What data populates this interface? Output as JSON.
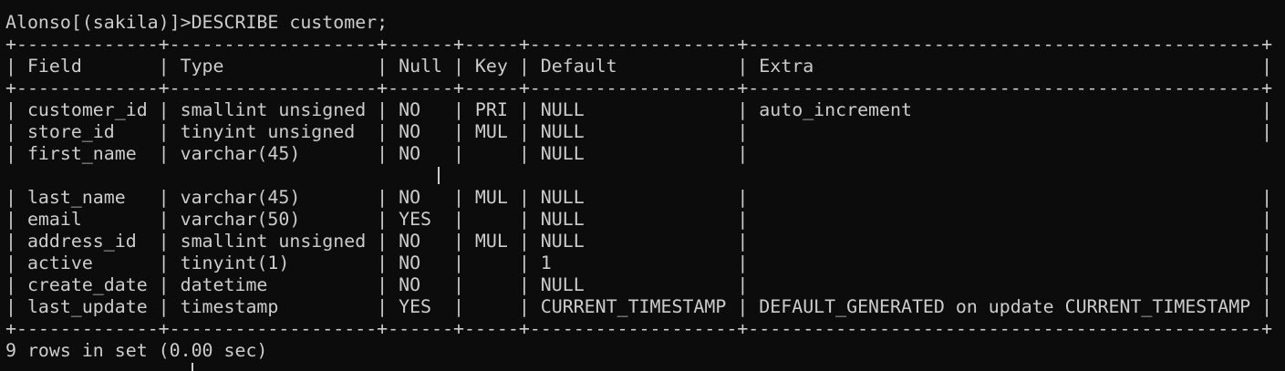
{
  "terminal": {
    "prompt": "Alonso[(sakila)]>",
    "command": "DESCRIBE customer;",
    "border_top": "+-------------+-------------------+------+-----+-------------------+-----------------------------------------------+",
    "header_row": "| Field       | Type              | Null | Key | Default           | Extra                                         |",
    "border_mid": "+-------------+-------------------+------+-----+-------------------+-----------------------------------------------+",
    "rows": [
      "| customer_id | smallint unsigned | NO   | PRI | NULL              | auto_increment                                |",
      "| store_id    | tinyint unsigned  | NO   | MUL | NULL              |                                               |",
      "| first_name  | varchar(45)       | NO   |     | NULL              |",
      "",
      "| last_name   | varchar(45)       | NO   | MUL | NULL              |                                               |",
      "| email       | varchar(50)       | YES  |     | NULL              |                                               |",
      "| address_id  | smallint unsigned | NO   | MUL | NULL              |                                               |",
      "| active      | tinyint(1)        | NO   |     | 1                 |                                               |",
      "| create_date | datetime          | NO   |     | NULL              |                                               |",
      "| last_update | timestamp         | YES  |     | CURRENT_TIMESTAMP | DEFAULT_GENERATED on update CURRENT_TIMESTAMP |"
    ],
    "border_bottom": "+-------------+-------------------+------+-----+-------------------+-----------------------------------------------+",
    "result_summary": "9 rows in set (0.00 sec)"
  }
}
